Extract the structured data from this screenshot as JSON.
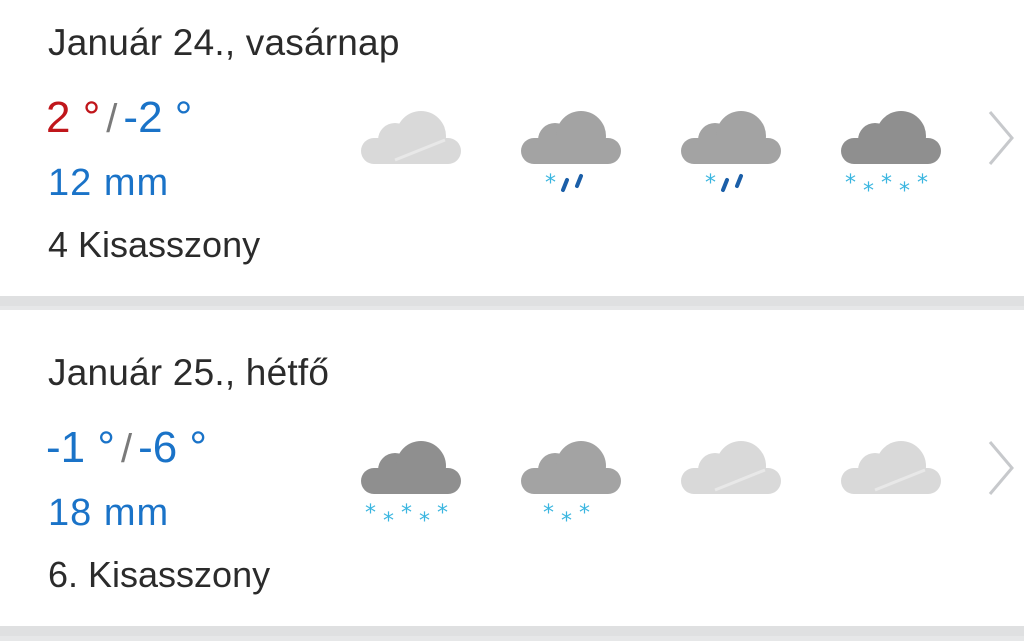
{
  "days": [
    {
      "title": "Január 24., vasárnap",
      "temp_max": "2 °",
      "temp_separator": "/",
      "temp_min": "-2 °",
      "temp_max_color": "#c0161b",
      "precipitation": "12  mm",
      "nameday": "4 Kisasszony",
      "icons": [
        "cloud-light-icon",
        "cloud-sleet-icon",
        "cloud-sleet-icon",
        "cloud-snow-icon"
      ]
    },
    {
      "title": "Január 25., hétfő",
      "temp_max": "-1 °",
      "temp_separator": "/",
      "temp_min": "-6 °",
      "temp_max_color": "#1a73c8",
      "precipitation": "18  mm",
      "nameday": "6. Kisasszony",
      "icons": [
        "cloud-snow-icon",
        "cloud-light-snow-icon",
        "cloud-light-icon",
        "cloud-light-icon"
      ]
    }
  ],
  "colors": {
    "warm_temp": "#c0161b",
    "cold_temp": "#1a73c8",
    "snow": "#3bb6e0",
    "rain": "#1b5fa8"
  }
}
